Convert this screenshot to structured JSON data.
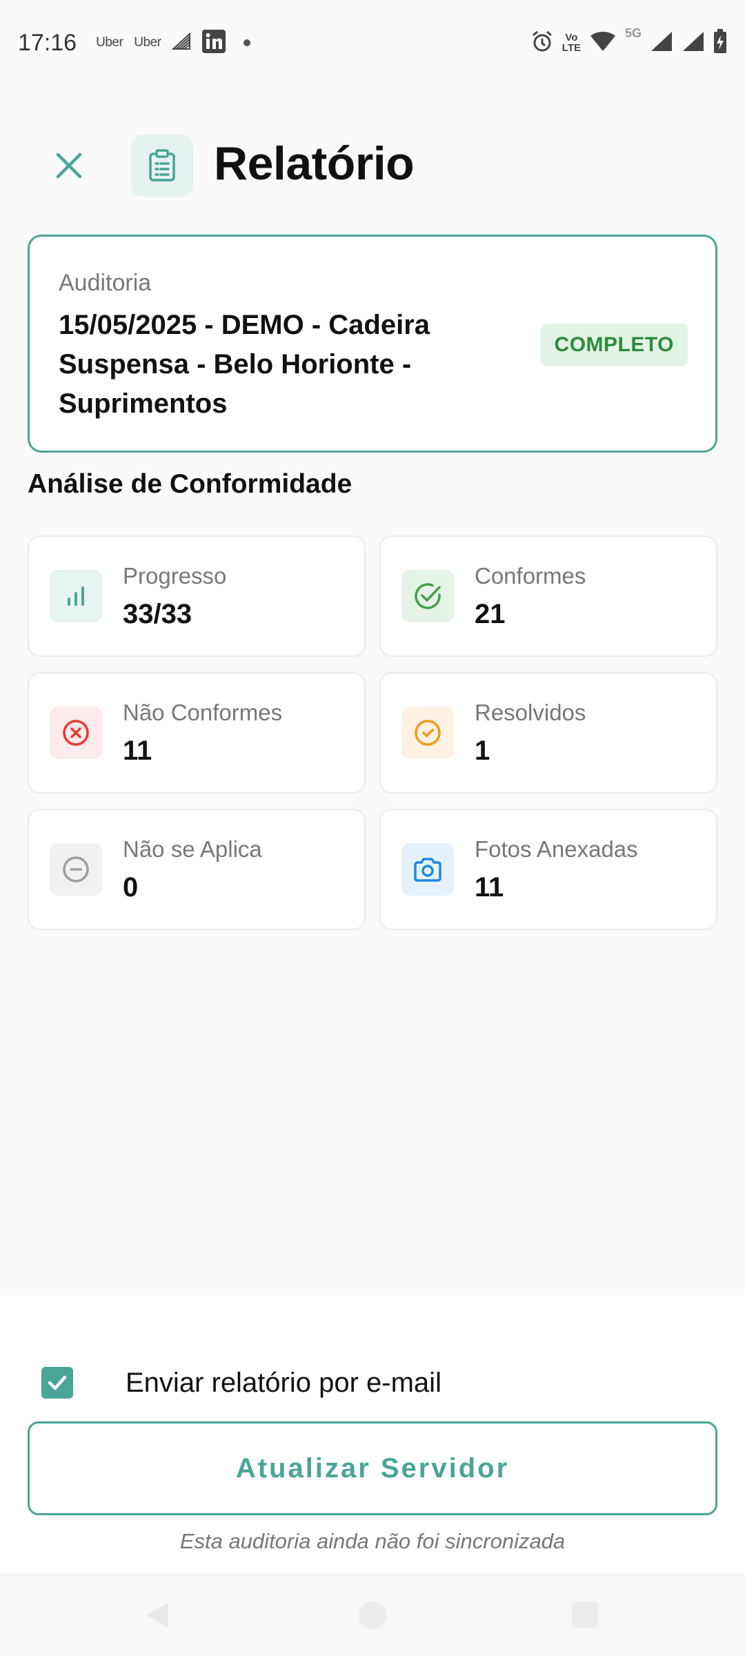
{
  "status_bar": {
    "time": "17:16",
    "notifications": [
      "Uber",
      "Uber"
    ],
    "network": "5G",
    "volte": [
      "Vo",
      "LTE"
    ]
  },
  "header": {
    "title": "Relatório"
  },
  "audit": {
    "label": "Auditoria",
    "name": "15/05/2025 - DEMO - Cadeira Suspensa - Belo Horionte - Suprimentos",
    "status": "COMPLETO"
  },
  "analysis": {
    "title": "Análise de Conformidade",
    "stats": [
      {
        "label": "Progresso",
        "value": "33/33",
        "icon": "bar-chart-icon",
        "color": "#4aa597",
        "bg": "#e8f4f1"
      },
      {
        "label": "Conformes",
        "value": "21",
        "icon": "check-circle-icon",
        "color": "#43a047",
        "bg": "#e6f4e7"
      },
      {
        "label": "Não Conformes",
        "value": "11",
        "icon": "x-circle-icon",
        "color": "#e53935",
        "bg": "#fdeaea"
      },
      {
        "label": "Resolvidos",
        "value": "1",
        "icon": "check-circle-icon",
        "color": "#f09a1a",
        "bg": "#fdf1e2"
      },
      {
        "label": "Não se Aplica",
        "value": "0",
        "icon": "minus-circle-icon",
        "color": "#9e9e9e",
        "bg": "#f1f1f1"
      },
      {
        "label": "Fotos Anexadas",
        "value": "11",
        "icon": "camera-icon",
        "color": "#1e88e5",
        "bg": "#e5f1fc"
      }
    ]
  },
  "footer": {
    "email_label": "Enviar relatório por e-mail",
    "email_checked": true,
    "update_button": "Atualizar Servidor",
    "sync_note": "Esta auditoria ainda não foi sincronizada"
  },
  "colors": {
    "accent": "#4aa597",
    "badge_text": "#2e8b3a",
    "badge_bg": "#e3f4e6"
  }
}
